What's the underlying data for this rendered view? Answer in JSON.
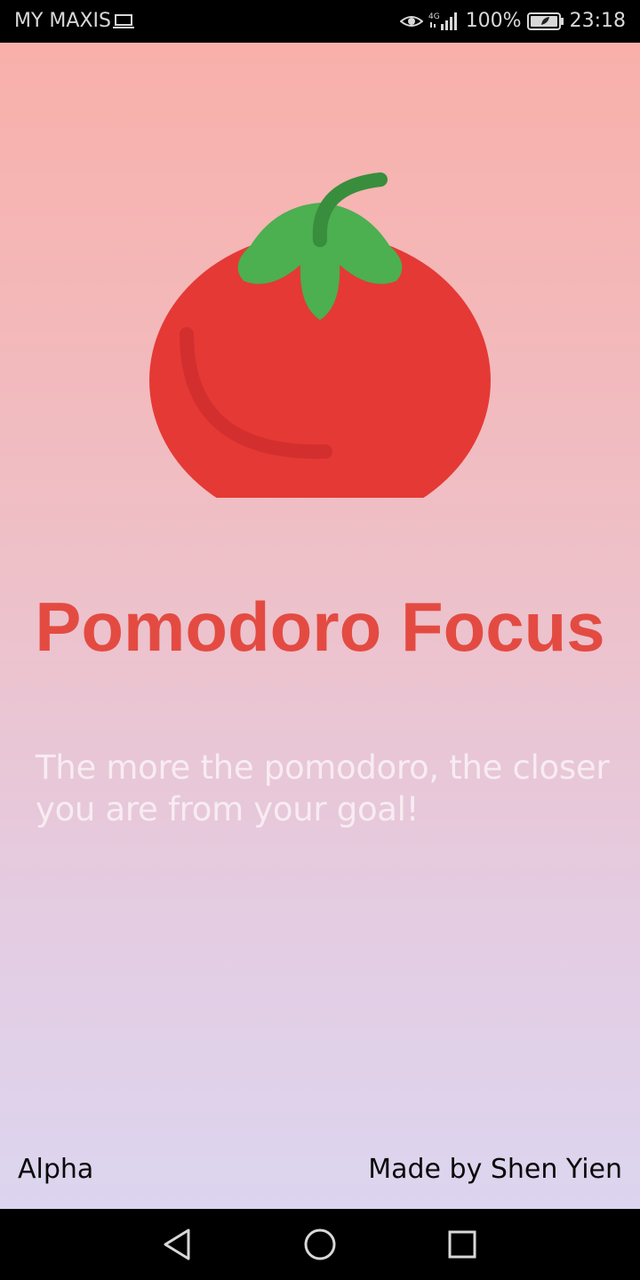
{
  "status_bar": {
    "carrier": "MY MAXIS",
    "network_type": "4G",
    "battery": "100%",
    "time": "23:18",
    "icons": [
      "laptop-icon",
      "eye-icon",
      "signal-icon",
      "battery-icon"
    ]
  },
  "app": {
    "title": "Pomodoro Focus",
    "tagline": "The more the pomodoro, the closer you are from your goal!",
    "footer_left": "Alpha",
    "footer_right": "Made by Shen Yien",
    "logo": "tomato-icon"
  },
  "colors": {
    "title": "#e34b42",
    "tomato_body": "#e53935",
    "tomato_leaves": "#4caf50",
    "tomato_stem": "#388e3c"
  },
  "nav_bar": {
    "icons": [
      "back-icon",
      "home-icon",
      "recents-icon"
    ]
  }
}
